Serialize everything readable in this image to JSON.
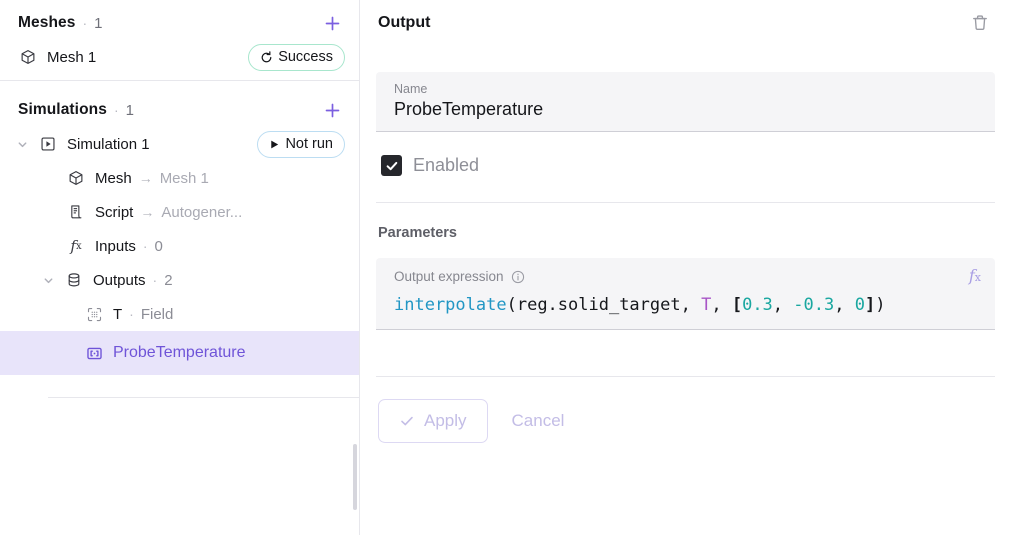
{
  "sidebar": {
    "meshes_section": {
      "title": "Meshes",
      "separator": "·",
      "count": "1",
      "add_icon": "plus-icon"
    },
    "mesh_item": {
      "label": "Mesh 1",
      "icon": "cube-icon",
      "badge": "Success",
      "badge_icon": "refresh-icon"
    },
    "simulations_section": {
      "title": "Simulations",
      "separator": "·",
      "count": "1",
      "add_icon": "plus-icon"
    },
    "simulation_item": {
      "label": "Simulation 1",
      "icon": "play-square-icon",
      "caret": "chevron-down-icon",
      "badge": "Not run",
      "badge_icon": "play-icon"
    },
    "tree": [
      {
        "name": "mesh",
        "icon": "cube-icon",
        "label": "Mesh",
        "arrow": "→",
        "value": "Mesh 1"
      },
      {
        "name": "script",
        "icon": "script-icon",
        "label": "Script",
        "arrow": "→",
        "value": "Autogener..."
      },
      {
        "name": "inputs",
        "icon": "fx-icon",
        "label": "Inputs",
        "separator": "·",
        "value": "0"
      },
      {
        "name": "outputs",
        "icon": "database-icon",
        "label": "Outputs",
        "separator": "·",
        "value": "2",
        "caret": "chevron-down-icon"
      }
    ],
    "outputs": [
      {
        "name": "t-field",
        "icon": "field-scan-icon",
        "label": "T",
        "separator": "·",
        "value": "Field",
        "selected": false
      },
      {
        "name": "probe-temperature",
        "icon": "probe-icon",
        "label": "ProbeTemperature",
        "selected": true
      }
    ]
  },
  "panel": {
    "title": "Output",
    "delete_icon": "trash-icon",
    "name_field": {
      "label": "Name",
      "value": "ProbeTemperature"
    },
    "enabled": {
      "label": "Enabled",
      "checked": true,
      "check_icon": "check-icon"
    },
    "parameters": {
      "section_label": "Parameters",
      "expression": {
        "label": "Output expression",
        "info_icon": "info-circle-icon",
        "fx_icon": "fx-icon",
        "value": "interpolate(reg.solid_target, T, [0.3, -0.3, 0])",
        "tokens": [
          {
            "t": "interpolate",
            "c": "tok-fn"
          },
          {
            "t": "(",
            "c": "tok-pun"
          },
          {
            "t": "reg.solid_target",
            "c": "tok-var"
          },
          {
            "t": ", ",
            "c": "tok-pun"
          },
          {
            "t": "T",
            "c": "tok-sym"
          },
          {
            "t": ", ",
            "c": "tok-pun"
          },
          {
            "t": "[",
            "c": "tok-brk"
          },
          {
            "t": "0.3",
            "c": "tok-num"
          },
          {
            "t": ", ",
            "c": "tok-pun"
          },
          {
            "t": "-0.3",
            "c": "tok-num"
          },
          {
            "t": ", ",
            "c": "tok-pun"
          },
          {
            "t": "0",
            "c": "tok-num"
          },
          {
            "t": "]",
            "c": "tok-brk"
          },
          {
            "t": ")",
            "c": "tok-pun"
          }
        ]
      }
    },
    "actions": {
      "apply_label": "Apply",
      "apply_icon": "check-icon",
      "apply_disabled": true,
      "cancel_label": "Cancel",
      "cancel_disabled": true
    }
  },
  "colors": {
    "accent": "#7b5fe0",
    "selected_bg": "#e8e4fa",
    "success_border": "#a8e6cd",
    "notrun_border": "#bcddf2",
    "code_fn": "#2196c4",
    "code_num": "#1aa7a0",
    "code_sym": "#a855c7"
  }
}
